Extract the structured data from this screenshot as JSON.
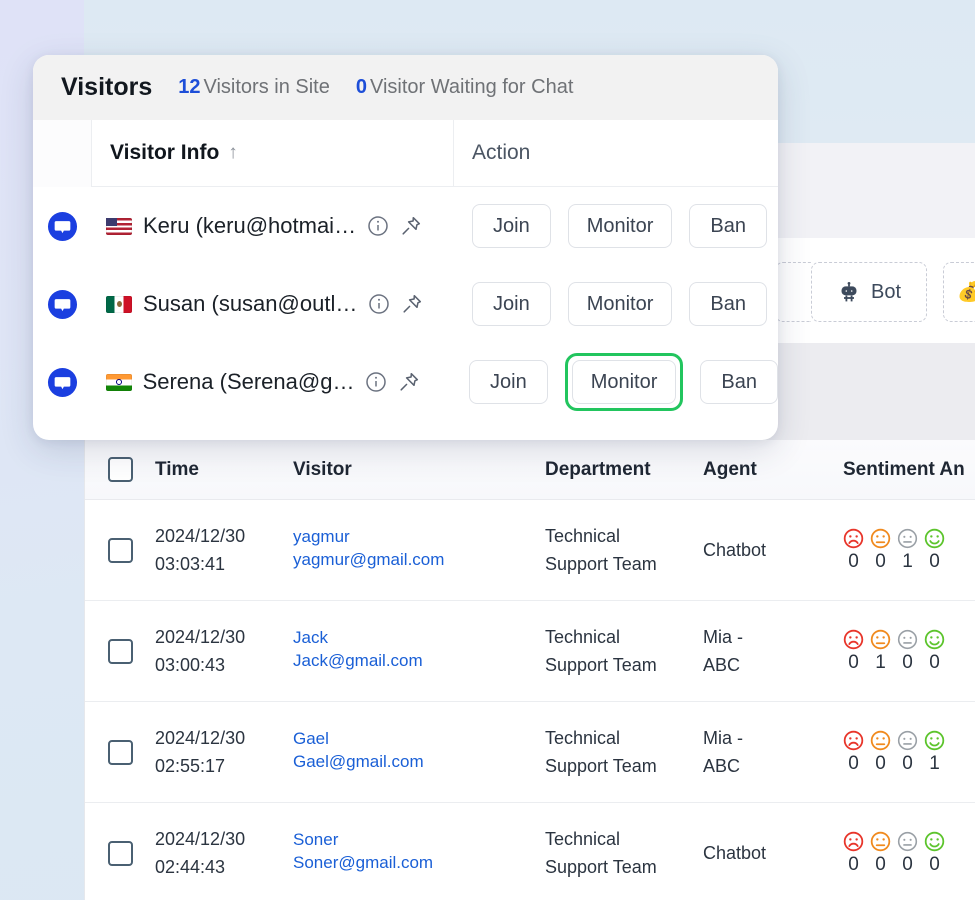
{
  "background": {
    "toolbar_chips": [
      {
        "name": "partial-left-chip",
        "label": ""
      },
      {
        "name": "bot-chip",
        "label": "Bot",
        "icon": "robot-icon"
      },
      {
        "name": "partial-right-chip",
        "label": "",
        "icon": "money-icon"
      }
    ]
  },
  "visitors_popup": {
    "title": "Visitors",
    "stats": [
      {
        "count": "12",
        "label": "Visitors in Site"
      },
      {
        "count": "0",
        "label": "Visitor Waiting for Chat"
      }
    ],
    "columns": {
      "visitor_info": "Visitor Info",
      "sort_indicator": "↑",
      "action": "Action"
    },
    "actions": {
      "join": "Join",
      "monitor": "Monitor",
      "ban": "Ban"
    },
    "rows": [
      {
        "chat_icon": "chat-bubble-icon",
        "flag": "us",
        "name": "Keru (keru@hotmai…",
        "info_icon": "info-icon",
        "pin_icon": "pin-icon",
        "focused_action": null
      },
      {
        "chat_icon": "chat-bubble-icon",
        "flag": "mx",
        "name": "Susan (susan@outl…",
        "info_icon": "info-icon",
        "pin_icon": "pin-icon",
        "focused_action": null
      },
      {
        "chat_icon": "chat-bubble-icon",
        "flag": "in",
        "name": "Serena (Serena@g…",
        "info_icon": "info-icon",
        "pin_icon": "pin-icon",
        "focused_action": "monitor"
      }
    ]
  },
  "data_table": {
    "headers": {
      "select_all": "",
      "time": "Time",
      "visitor": "Visitor",
      "department": "Department",
      "agent": "Agent",
      "sentiment": "Sentiment An"
    },
    "sentiment_faces": [
      "angry-face-icon",
      "sad-face-icon",
      "neutral-face-icon",
      "happy-face-icon"
    ],
    "rows": [
      {
        "date": "2024/12/30",
        "time": "03:03:41",
        "visitor_name": "yagmur",
        "visitor_email": "yagmur@gmail.com",
        "department_line1": "Technical",
        "department_line2": "Support Team",
        "agent_line1": "Chatbot",
        "agent_line2": "",
        "sentiment_counts": [
          "0",
          "0",
          "1",
          "0"
        ]
      },
      {
        "date": "2024/12/30",
        "time": "03:00:43",
        "visitor_name": "Jack",
        "visitor_email": "Jack@gmail.com",
        "department_line1": "Technical",
        "department_line2": "Support Team",
        "agent_line1": "Mia -",
        "agent_line2": "ABC",
        "sentiment_counts": [
          "0",
          "1",
          "0",
          "0"
        ]
      },
      {
        "date": "2024/12/30",
        "time": "02:55:17",
        "visitor_name": "Gael",
        "visitor_email": "Gael@gmail.com",
        "department_line1": "Technical",
        "department_line2": "Support Team",
        "agent_line1": "Mia -",
        "agent_line2": "ABC",
        "sentiment_counts": [
          "0",
          "0",
          "0",
          "1"
        ]
      },
      {
        "date": "2024/12/30",
        "time": "02:44:43",
        "visitor_name": "Soner",
        "visitor_email": "Soner@gmail.com",
        "department_line1": "Technical",
        "department_line2": "Support Team",
        "agent_line1": "Chatbot",
        "agent_line2": "",
        "sentiment_counts": [
          "0",
          "0",
          "0",
          "0"
        ]
      }
    ]
  },
  "colors": {
    "accent_blue": "#1d4ed8",
    "link_blue": "#1a5fd6",
    "focus_green": "#22c55e",
    "sentiment_angry": "#e8352a",
    "sentiment_sad": "#f08a1e",
    "sentiment_neutral": "#9aa0a6",
    "sentiment_happy": "#5cc42c"
  }
}
